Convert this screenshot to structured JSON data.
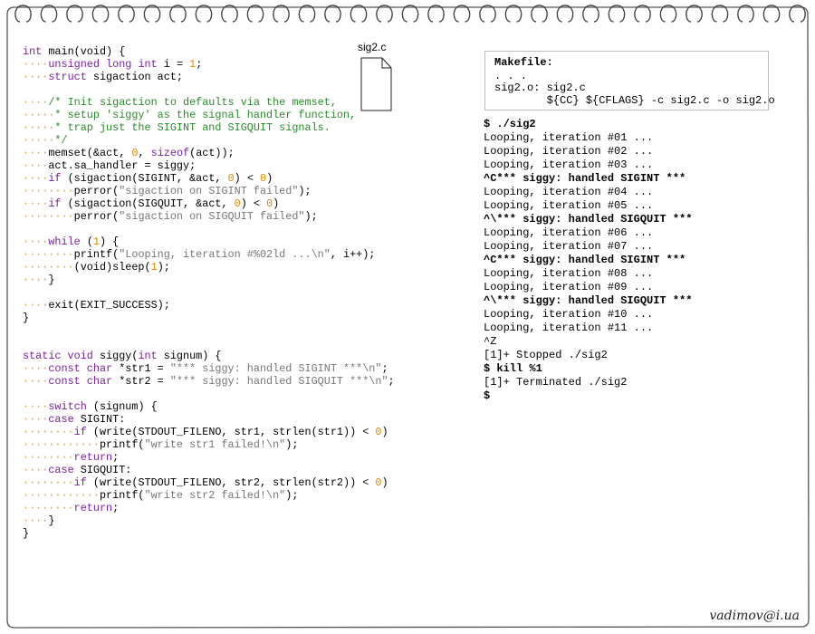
{
  "file": {
    "name": "sig2.c"
  },
  "code_lines": [
    [
      {
        "t": "int",
        "c": "ty"
      },
      {
        "t": " main(void) {"
      }
    ],
    [
      {
        "t": "····",
        "c": "ws"
      },
      {
        "t": "unsigned long int",
        "c": "ty"
      },
      {
        "t": " i ",
        "c": ""
      },
      {
        "t": "=",
        "c": ""
      },
      {
        "t": " ",
        "c": ""
      },
      {
        "t": "1",
        "c": "num"
      },
      {
        "t": ";"
      }
    ],
    [
      {
        "t": "····",
        "c": "ws"
      },
      {
        "t": "struct",
        "c": "ty"
      },
      {
        "t": " sigaction act;"
      }
    ],
    [
      {
        "t": ""
      }
    ],
    [
      {
        "t": "····",
        "c": "ws"
      },
      {
        "t": "/* Init sigaction to defaults via the memset,",
        "c": "com"
      }
    ],
    [
      {
        "t": "·····",
        "c": "ws"
      },
      {
        "t": "* setup 'siggy' as the signal handler function,",
        "c": "com"
      }
    ],
    [
      {
        "t": "·····",
        "c": "ws"
      },
      {
        "t": "* trap just the SIGINT and SIGQUIT signals.",
        "c": "com"
      }
    ],
    [
      {
        "t": "·····",
        "c": "ws"
      },
      {
        "t": "*/",
        "c": "com"
      }
    ],
    [
      {
        "t": "····",
        "c": "ws"
      },
      {
        "t": "memset(&act, "
      },
      {
        "t": "0",
        "c": "num"
      },
      {
        "t": ", "
      },
      {
        "t": "sizeof",
        "c": "kw"
      },
      {
        "t": "(act));"
      }
    ],
    [
      {
        "t": "····",
        "c": "ws"
      },
      {
        "t": "act.sa_handler = siggy;"
      }
    ],
    [
      {
        "t": "····",
        "c": "ws"
      },
      {
        "t": "if",
        "c": "kw"
      },
      {
        "t": " (sigaction(SIGINT, &act, "
      },
      {
        "t": "0",
        "c": "num"
      },
      {
        "t": ") < "
      },
      {
        "t": "0",
        "c": "num"
      },
      {
        "t": ")"
      }
    ],
    [
      {
        "t": "········",
        "c": "ws"
      },
      {
        "t": "perror("
      },
      {
        "t": "\"sigaction on SIGINT failed\"",
        "c": "str"
      },
      {
        "t": ");"
      }
    ],
    [
      {
        "t": "····",
        "c": "ws"
      },
      {
        "t": "if",
        "c": "kw"
      },
      {
        "t": " (sigaction(SIGQUIT, &act, "
      },
      {
        "t": "0",
        "c": "num"
      },
      {
        "t": ") < "
      },
      {
        "t": "0",
        "c": "num"
      },
      {
        "t": ")"
      }
    ],
    [
      {
        "t": "········",
        "c": "ws"
      },
      {
        "t": "perror("
      },
      {
        "t": "\"sigaction on SIGQUIT failed\"",
        "c": "str"
      },
      {
        "t": ");"
      }
    ],
    [
      {
        "t": ""
      }
    ],
    [
      {
        "t": "····",
        "c": "ws"
      },
      {
        "t": "while",
        "c": "kw"
      },
      {
        "t": " ("
      },
      {
        "t": "1",
        "c": "num"
      },
      {
        "t": ") {"
      }
    ],
    [
      {
        "t": "········",
        "c": "ws"
      },
      {
        "t": "printf("
      },
      {
        "t": "\"Looping, iteration #%02ld ...\\n\"",
        "c": "str"
      },
      {
        "t": ", i++);"
      }
    ],
    [
      {
        "t": "········",
        "c": "ws"
      },
      {
        "t": "(void)sleep("
      },
      {
        "t": "1",
        "c": "num"
      },
      {
        "t": ");"
      }
    ],
    [
      {
        "t": "····",
        "c": "ws"
      },
      {
        "t": "}"
      }
    ],
    [
      {
        "t": ""
      }
    ],
    [
      {
        "t": "····",
        "c": "ws"
      },
      {
        "t": "exit(EXIT_SUCCESS);"
      }
    ],
    [
      {
        "t": "}"
      }
    ],
    [
      {
        "t": ""
      }
    ],
    [
      {
        "t": ""
      }
    ],
    [
      {
        "t": "static void",
        "c": "kw"
      },
      {
        "t": " siggy("
      },
      {
        "t": "int",
        "c": "ty"
      },
      {
        "t": " signum) {"
      }
    ],
    [
      {
        "t": "····",
        "c": "ws"
      },
      {
        "t": "const char",
        "c": "kw"
      },
      {
        "t": " *str1 = "
      },
      {
        "t": "\"*** siggy: handled SIGINT ***\\n\"",
        "c": "str"
      },
      {
        "t": ";"
      }
    ],
    [
      {
        "t": "····",
        "c": "ws"
      },
      {
        "t": "const char",
        "c": "kw"
      },
      {
        "t": " *str2 = "
      },
      {
        "t": "\"*** siggy: handled SIGQUIT ***\\n\"",
        "c": "str"
      },
      {
        "t": ";"
      }
    ],
    [
      {
        "t": ""
      }
    ],
    [
      {
        "t": "····",
        "c": "ws"
      },
      {
        "t": "switch",
        "c": "kw"
      },
      {
        "t": " (signum) {"
      }
    ],
    [
      {
        "t": "····",
        "c": "ws"
      },
      {
        "t": "case",
        "c": "kw"
      },
      {
        "t": " SIGINT:"
      }
    ],
    [
      {
        "t": "········",
        "c": "ws"
      },
      {
        "t": "if",
        "c": "kw"
      },
      {
        "t": " (write(STDOUT_FILENO, str1, strlen(str1)) < "
      },
      {
        "t": "0",
        "c": "num"
      },
      {
        "t": ")"
      }
    ],
    [
      {
        "t": "············",
        "c": "ws"
      },
      {
        "t": "printf("
      },
      {
        "t": "\"write str1 failed!\\n\"",
        "c": "str"
      },
      {
        "t": ");"
      }
    ],
    [
      {
        "t": "········",
        "c": "ws"
      },
      {
        "t": "return",
        "c": "kw"
      },
      {
        "t": ";"
      }
    ],
    [
      {
        "t": "····",
        "c": "ws"
      },
      {
        "t": "case",
        "c": "kw"
      },
      {
        "t": " SIGQUIT:"
      }
    ],
    [
      {
        "t": "········",
        "c": "ws"
      },
      {
        "t": "if",
        "c": "kw"
      },
      {
        "t": " (write(STDOUT_FILENO, str2, strlen(str2)) < "
      },
      {
        "t": "0",
        "c": "num"
      },
      {
        "t": ")"
      }
    ],
    [
      {
        "t": "············",
        "c": "ws"
      },
      {
        "t": "printf("
      },
      {
        "t": "\"write str2 failed!\\n\"",
        "c": "str"
      },
      {
        "t": ");"
      }
    ],
    [
      {
        "t": "········",
        "c": "ws"
      },
      {
        "t": "return",
        "c": "kw"
      },
      {
        "t": ";"
      }
    ],
    [
      {
        "t": "····",
        "c": "ws"
      },
      {
        "t": "}"
      }
    ],
    [
      {
        "t": "}"
      }
    ]
  ],
  "makefile": {
    "title": "Makefile:",
    "lines": [
      ". . .",
      "sig2.o: sig2.c",
      "        ${CC} ${CFLAGS} -c sig2.c -o sig2.o"
    ]
  },
  "terminal": [
    {
      "text": "$ ./sig2",
      "bold": true
    },
    {
      "text": "Looping, iteration #01 ...",
      "bold": false
    },
    {
      "text": "Looping, iteration #02 ...",
      "bold": false
    },
    {
      "text": "Looping, iteration #03 ...",
      "bold": false
    },
    {
      "text": "^C*** siggy: handled SIGINT ***",
      "bold": true
    },
    {
      "text": "Looping, iteration #04 ...",
      "bold": false
    },
    {
      "text": "Looping, iteration #05 ...",
      "bold": false
    },
    {
      "text": "^\\*** siggy: handled SIGQUIT ***",
      "bold": true
    },
    {
      "text": "Looping, iteration #06 ...",
      "bold": false
    },
    {
      "text": "Looping, iteration #07 ...",
      "bold": false
    },
    {
      "text": "^C*** siggy: handled SIGINT ***",
      "bold": true
    },
    {
      "text": "Looping, iteration #08 ...",
      "bold": false
    },
    {
      "text": "Looping, iteration #09 ...",
      "bold": false
    },
    {
      "text": "^\\*** siggy: handled SIGQUIT ***",
      "bold": true
    },
    {
      "text": "Looping, iteration #10 ...",
      "bold": false
    },
    {
      "text": "Looping, iteration #11 ...",
      "bold": false
    },
    {
      "text": "^Z",
      "bold": false
    },
    {
      "text": "[1]+ Stopped ./sig2",
      "bold": false
    },
    {
      "text": "$ kill %1",
      "bold": true
    },
    {
      "text": "[1]+ Terminated ./sig2",
      "bold": false
    },
    {
      "text": "$",
      "bold": true
    }
  ],
  "signature": "vadimov@i.ua",
  "colors": {
    "keyword": "#7b1fa2",
    "number": "#e08600",
    "string": "#777777",
    "comment": "#2a8a2a",
    "whitespace_dots": "#d39b3f"
  }
}
